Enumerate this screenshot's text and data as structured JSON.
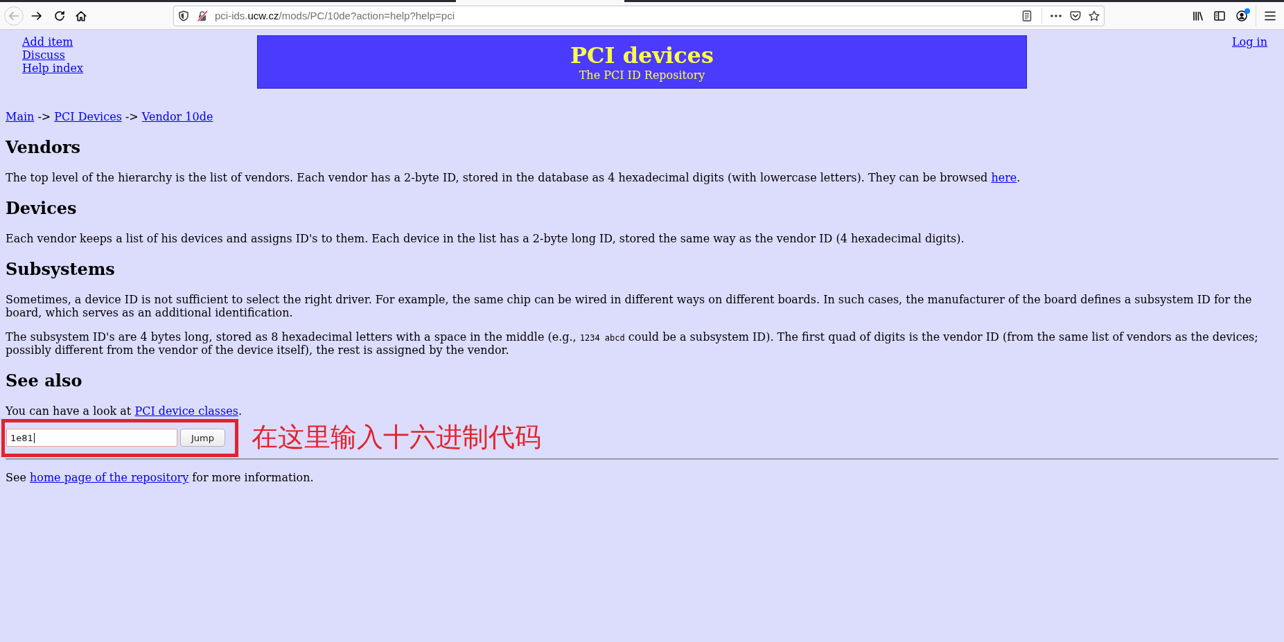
{
  "browser": {
    "back_button": {
      "disabled": true
    },
    "url": {
      "prefix": "pci-ids.",
      "domain": "ucw.cz",
      "path": "/mods/PC/10de?action=help?help=pci"
    },
    "account_badge": true
  },
  "nav_links": [
    "Add item",
    "Discuss",
    "Help index"
  ],
  "header": {
    "title": "PCI devices",
    "subtitle": "The PCI ID Repository"
  },
  "login_link": "Log in",
  "breadcrumb": [
    {
      "kind": "link",
      "text": "Main"
    },
    {
      "kind": "text",
      "text": " -> "
    },
    {
      "kind": "link",
      "text": "PCI Devices"
    },
    {
      "kind": "text",
      "text": " -> "
    },
    {
      "kind": "link",
      "text": "Vendor 10de"
    }
  ],
  "sections": [
    {
      "heading": "Vendors",
      "paragraphs": [
        [
          {
            "kind": "text",
            "text": "The top level of the hierarchy is the list of vendors. Each vendor has a 2-byte ID, stored in the database as 4 hexadecimal digits (with lowercase letters). They can be browsed "
          },
          {
            "kind": "link",
            "text": "here"
          },
          {
            "kind": "text",
            "text": "."
          }
        ]
      ]
    },
    {
      "heading": "Devices",
      "paragraphs": [
        [
          {
            "kind": "text",
            "text": "Each vendor keeps a list of his devices and assigns ID's to them. Each device in the list has a 2-byte long ID, stored the same way as the vendor ID (4 hexadecimal digits)."
          }
        ]
      ]
    },
    {
      "heading": "Subsystems",
      "paragraphs": [
        [
          {
            "kind": "text",
            "text": "Sometimes, a device ID is not sufficient to select the right driver. For example, the same chip can be wired in different ways on different boards. In such cases, the manufacturer of the board defines a subsystem ID for the board, which serves as an additional identification."
          }
        ],
        [
          {
            "kind": "text",
            "text": "The subsystem ID's are 4 bytes long, stored as 8 hexadecimal letters with a space in the middle (e.g., "
          },
          {
            "kind": "code",
            "text": "1234 abcd"
          },
          {
            "kind": "text",
            "text": " could be a subsystem ID). The first quad of digits is the vendor ID (from the same list of vendors as the devices; possibly different from the vendor of the device itself), the rest is assigned by the vendor."
          }
        ]
      ]
    },
    {
      "heading": "See also",
      "paragraphs": [
        [
          {
            "kind": "text",
            "text": "You can have a look at "
          },
          {
            "kind": "link",
            "text": "PCI device classes"
          },
          {
            "kind": "text",
            "text": "."
          }
        ]
      ]
    }
  ],
  "form": {
    "field": {
      "value": "1e81",
      "focused": true
    },
    "button": "Jump"
  },
  "annotation": {
    "text": "在这里输入十六进制代码"
  },
  "footer": [
    {
      "kind": "text",
      "text": "See "
    },
    {
      "kind": "link",
      "text": "home page of the repository"
    },
    {
      "kind": "text",
      "text": " for more information."
    }
  ]
}
